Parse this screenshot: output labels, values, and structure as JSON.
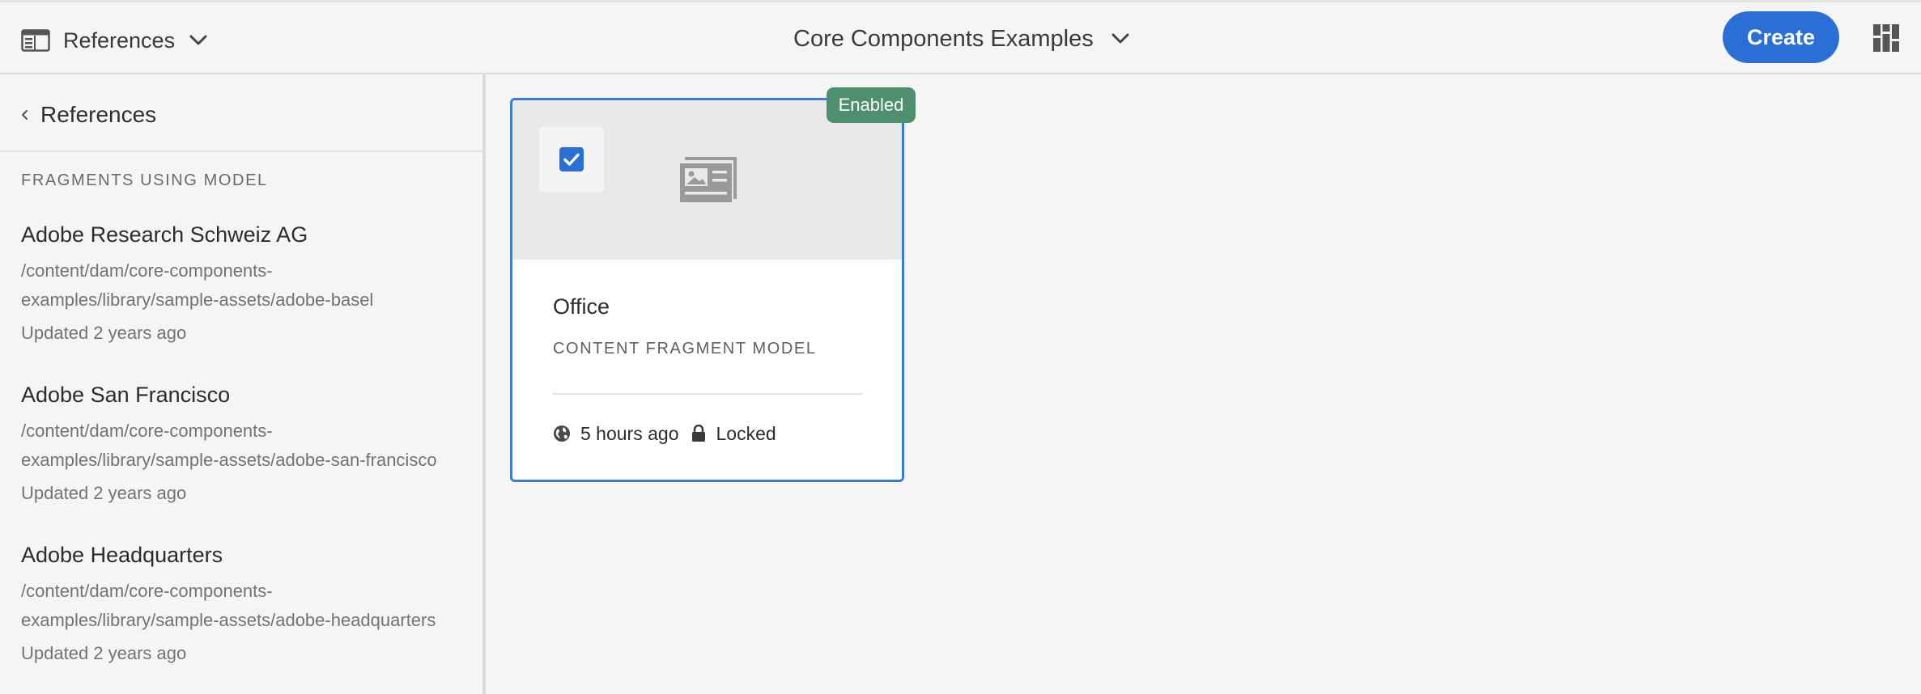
{
  "header": {
    "rail_label": "References",
    "title": "Core Components Examples",
    "create_label": "Create",
    "accent_color": "#2a6fd6"
  },
  "rail": {
    "back_label": "References",
    "section_heading": "FRAGMENTS USING MODEL",
    "items": [
      {
        "title": "Adobe Research Schweiz AG",
        "path_line1": "/content/dam/core-components-",
        "path_line2": "examples/library/sample-assets/adobe-basel",
        "updated": "Updated 2 years ago"
      },
      {
        "title": "Adobe San Francisco",
        "path_line1": "/content/dam/core-components-",
        "path_line2": "examples/library/sample-assets/adobe-san-francisco",
        "updated": "Updated 2 years ago"
      },
      {
        "title": "Adobe Headquarters",
        "path_line1": "/content/dam/core-components-",
        "path_line2": "examples/library/sample-assets/adobe-headquarters",
        "updated": "Updated 2 years ago"
      }
    ]
  },
  "card": {
    "badge": "Enabled",
    "badge_color": "#4e8f6f",
    "title": "Office",
    "subtitle": "CONTENT FRAGMENT MODEL",
    "modified": "5 hours ago",
    "lock_status": "Locked",
    "selected": true,
    "thumbnail_icon": "content-fragment-icon"
  }
}
